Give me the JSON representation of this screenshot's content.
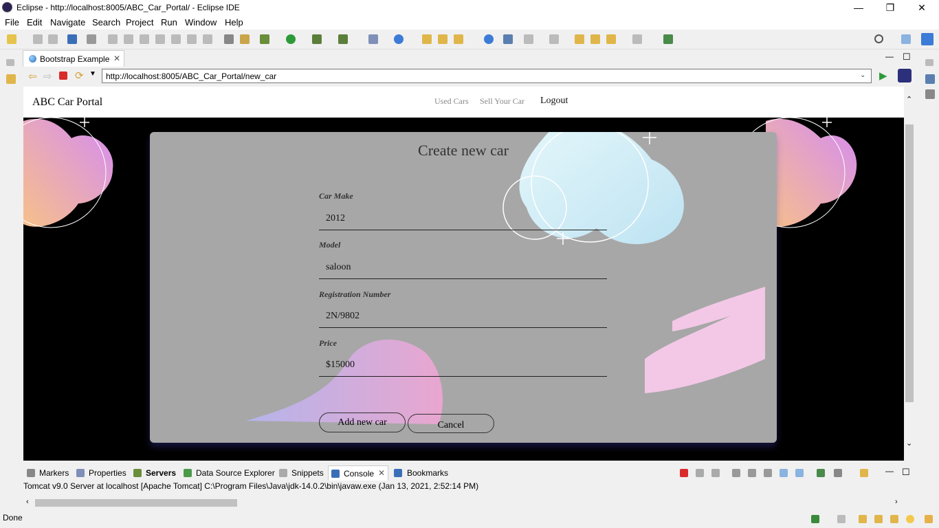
{
  "window": {
    "title": "Eclipse - http://localhost:8005/ABC_Car_Portal/ - Eclipse IDE",
    "minimize": "—",
    "restore": "❐",
    "close": "✕"
  },
  "menubar": {
    "items": [
      "File",
      "Edit",
      "Navigate",
      "Search",
      "Project",
      "Run",
      "Window",
      "Help"
    ]
  },
  "editor": {
    "tab_label": "Bootstrap Example",
    "tab_close": "✕"
  },
  "browser": {
    "url": "http://localhost:8005/ABC_Car_Portal/new_car",
    "go_icon": "play-icon"
  },
  "site": {
    "brand": "ABC Car Portal",
    "nav": [
      "Used Cars",
      "Sell Your Car",
      "Logout"
    ]
  },
  "form": {
    "title": "Create new car",
    "fields": [
      {
        "label": "Car Make",
        "value": "2012"
      },
      {
        "label": "Model",
        "value": "saloon"
      },
      {
        "label": "Registration Number",
        "value": "2N/9802"
      },
      {
        "label": "Price",
        "value": "$15000"
      }
    ],
    "submit_label": "Add new car",
    "cancel_label": "Cancel"
  },
  "bottom_panel": {
    "tabs": [
      "Markers",
      "Properties",
      "Servers",
      "Data Source Explorer",
      "Snippets",
      "Console",
      "Bookmarks"
    ],
    "active_tab": "Console",
    "console_info": "Tomcat v9.0 Server at localhost [Apache Tomcat] C:\\Program Files\\Java\\jdk-14.0.2\\bin\\javaw.exe  (Jan 13, 2021, 2:52:14 PM)"
  },
  "status": {
    "text": "Done"
  },
  "colors": {
    "accent": "#3c7bd6",
    "card": "#a7a7a7",
    "page_bg": "#000000",
    "stop_red": "#d92b2b",
    "run_green": "#2d9a3a"
  }
}
